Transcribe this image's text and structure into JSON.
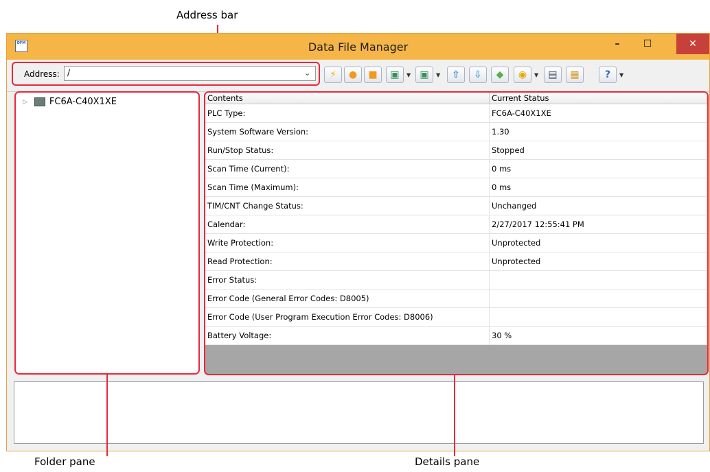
{
  "callouts": {
    "address_bar": "Address bar",
    "folder_pane": "Folder pane",
    "details_pane": "Details pane"
  },
  "window": {
    "title": "Data File Manager",
    "icon_text": "DFM",
    "minimize": "–",
    "maximize": "☐",
    "close": "✕"
  },
  "toolbar": {
    "address_label": "Address:",
    "address_value": "/",
    "buttons": [
      {
        "icon": "lightning-icon",
        "glyph": "⚡",
        "color": "#f4b400"
      },
      {
        "icon": "run-icon",
        "glyph": "●",
        "color": "#f39a1e"
      },
      {
        "icon": "stop-icon",
        "glyph": "■",
        "color": "#f39a1e"
      },
      {
        "icon": "window-icon-1",
        "glyph": "▣",
        "color": "#3c8f5a"
      },
      {
        "icon": "window-icon-2",
        "glyph": "▣",
        "color": "#3c8f5a"
      },
      {
        "icon": "upload-icon",
        "glyph": "⇧",
        "color": "#2b88c9"
      },
      {
        "icon": "download-icon",
        "glyph": "⇩",
        "color": "#4aa0d8"
      },
      {
        "icon": "back-icon",
        "glyph": "◆",
        "color": "#5aae4a"
      },
      {
        "icon": "coin-icon",
        "glyph": "◉",
        "color": "#e6a800"
      },
      {
        "icon": "save-icon",
        "glyph": "▤",
        "color": "#4a5a6a"
      },
      {
        "icon": "document-icon",
        "glyph": "▦",
        "color": "#d69a2a"
      },
      {
        "icon": "help-icon",
        "glyph": "?",
        "color": "#2b6cb8"
      }
    ]
  },
  "folder_pane": {
    "tree_item": "FC6A-C40X1XE"
  },
  "details": {
    "headers": [
      "Contents",
      "Current Status"
    ],
    "rows": [
      [
        "PLC Type:",
        "FC6A-C40X1XE"
      ],
      [
        "System Software Version:",
        "1.30"
      ],
      [
        "Run/Stop Status:",
        "Stopped"
      ],
      [
        "Scan Time (Current):",
        "0 ms"
      ],
      [
        "Scan Time (Maximum):",
        "0 ms"
      ],
      [
        "TIM/CNT Change Status:",
        "Unchanged"
      ],
      [
        "Calendar:",
        "2/27/2017 12:55:41 PM"
      ],
      [
        "Write Protection:",
        "Unprotected"
      ],
      [
        "Read Protection:",
        "Unprotected"
      ],
      [
        "Error Status:",
        ""
      ],
      [
        "Error Code (General Error Codes: D8005)",
        ""
      ],
      [
        "Error Code (User Program Execution Error Codes: D8006)",
        ""
      ],
      [
        "Battery Voltage:",
        "30 %"
      ]
    ]
  }
}
